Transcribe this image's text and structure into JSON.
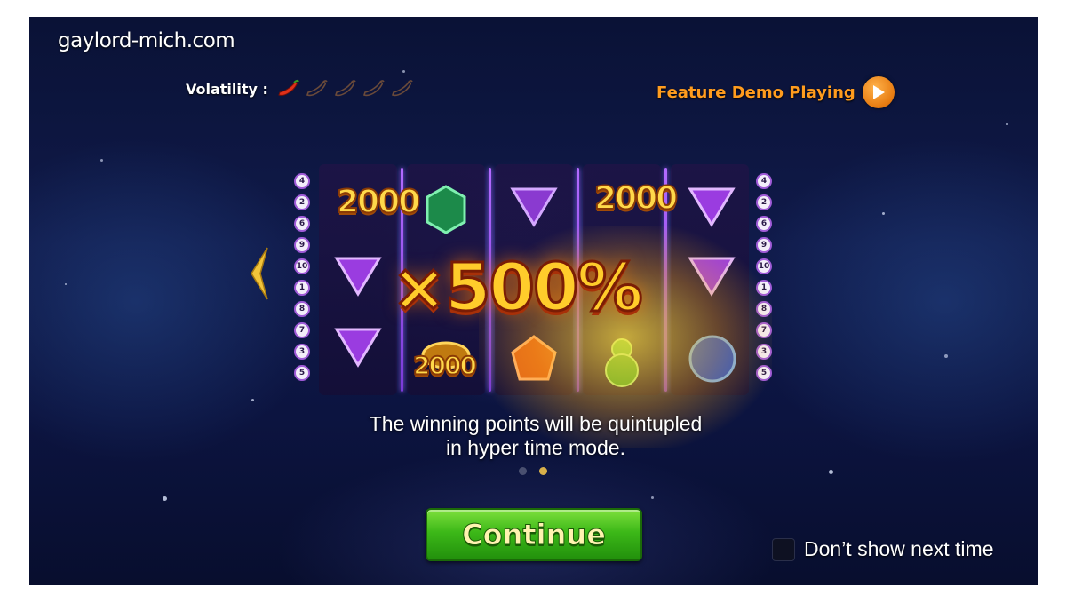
{
  "site": {
    "watermark": "gaylord-mich.com"
  },
  "volatility": {
    "label": "Volatility :",
    "level": 1,
    "max": 5,
    "icon": "chili-pepper-icon"
  },
  "feature_demo": {
    "label": "Feature Demo Playing",
    "icon": "play-icon"
  },
  "paylines": {
    "left": [
      "4",
      "2",
      "6",
      "9",
      "10",
      "1",
      "8",
      "7",
      "3",
      "5"
    ],
    "right": [
      "4",
      "2",
      "6",
      "9",
      "10",
      "1",
      "8",
      "7",
      "3",
      "5"
    ]
  },
  "reels": {
    "bonus_values": [
      "2000",
      "2000",
      "2000"
    ],
    "multiplier": "×500%"
  },
  "description": {
    "line1": "The winning points will be quintupled",
    "line2": "in hyper time mode."
  },
  "pagination": {
    "total": 2,
    "current": 2
  },
  "continue_button": {
    "label": "Continue"
  },
  "dont_show": {
    "label": "Don’t show next time",
    "checked": false
  },
  "colors": {
    "accent_orange": "#ff9c1e",
    "button_green": "#3cb818",
    "gold_text": "#ffd84a",
    "purple_frame": "#a05bd8"
  }
}
